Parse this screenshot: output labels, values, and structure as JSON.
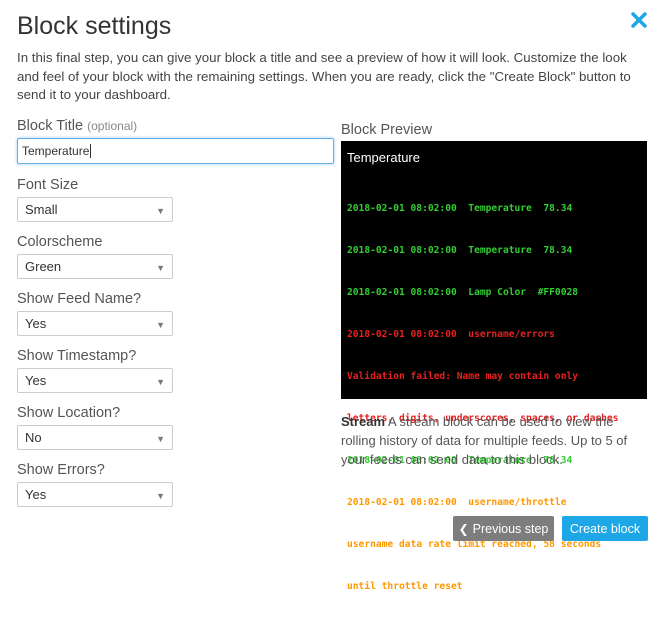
{
  "dialog": {
    "title": "Block settings",
    "close_icon": "close-x-icon",
    "intro": "In this final step, you can give your block a title and see a preview of how it will look. Customize the look and feel of your block with the remaining settings. When you are ready, click the \"Create Block\" button to send it to your dashboard."
  },
  "form": {
    "block_title": {
      "label": "Block Title",
      "optional": "(optional)",
      "value": "Temperature"
    },
    "font_size": {
      "label": "Font Size",
      "value": "Small"
    },
    "colorscheme": {
      "label": "Colorscheme",
      "value": "Green"
    },
    "show_feed_name": {
      "label": "Show Feed Name?",
      "value": "Yes"
    },
    "show_timestamp": {
      "label": "Show Timestamp?",
      "value": "Yes"
    },
    "show_location": {
      "label": "Show Location?",
      "value": "No"
    },
    "show_errors": {
      "label": "Show Errors?",
      "value": "Yes"
    }
  },
  "preview": {
    "label": "Block Preview",
    "title": "Temperature",
    "lines": [
      {
        "text": "2018-02-01 08:02:00  Temperature  78.34",
        "color": "green"
      },
      {
        "text": "2018-02-01 08:02:00  Temperature  78.34",
        "color": "green"
      },
      {
        "text": "2018-02-01 08:02:00  Lamp Color  #FF0028",
        "color": "green"
      },
      {
        "text": "2018-02-01 08:02:00  username/errors",
        "color": "red"
      },
      {
        "text": "Validation failed: Name may contain only",
        "color": "red"
      },
      {
        "text": "letters, digits, underscores, spaces, or dashes",
        "color": "red"
      },
      {
        "text": "2018-02-01 08:02:00  Temperature  78.34",
        "color": "green"
      },
      {
        "text": "2018-02-01 08:02:00  username/throttle",
        "color": "orange"
      },
      {
        "text": "username data rate limit reached, 58 seconds",
        "color": "orange"
      },
      {
        "text": "until throttle reset",
        "color": "orange"
      }
    ]
  },
  "stream": {
    "name": "Stream",
    "description": " A stream block can be used to view the rolling history of data for multiple feeds. Up to 5 of your feeds can send data to this block."
  },
  "buttons": {
    "previous": "Previous step",
    "previous_icon": "chevron-left-icon",
    "create": "Create block"
  },
  "colors": {
    "accent": "#1ea7e6",
    "close": "#1ea7e6",
    "green": "#33cc33",
    "red": "#e62020",
    "orange": "#ff9900"
  }
}
